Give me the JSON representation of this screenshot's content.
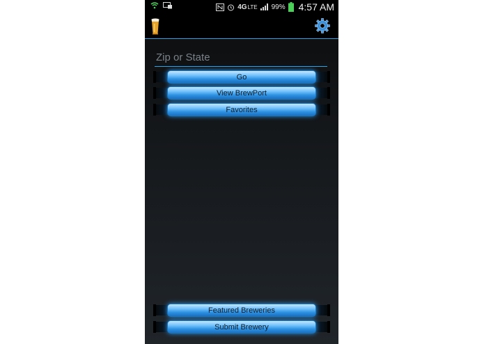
{
  "status_bar": {
    "network": "4G",
    "network_sub": "LTE",
    "battery": "99%",
    "time": "4:57 AM",
    "icons": [
      "wifi-icon",
      "message-icon",
      "nfc-icon",
      "alarm-icon",
      "signal-icon",
      "battery-icon"
    ]
  },
  "action_bar": {
    "app_icon": "beer-glass-icon",
    "settings_icon": "gear-icon",
    "accent_color": "#2aa3e8"
  },
  "search": {
    "placeholder": "Zip or State",
    "value": ""
  },
  "buttons": {
    "go": "Go",
    "view_brewport": "View BrewPort",
    "favorites": "Favorites",
    "featured": "Featured Breweries",
    "submit": "Submit Brewery"
  }
}
